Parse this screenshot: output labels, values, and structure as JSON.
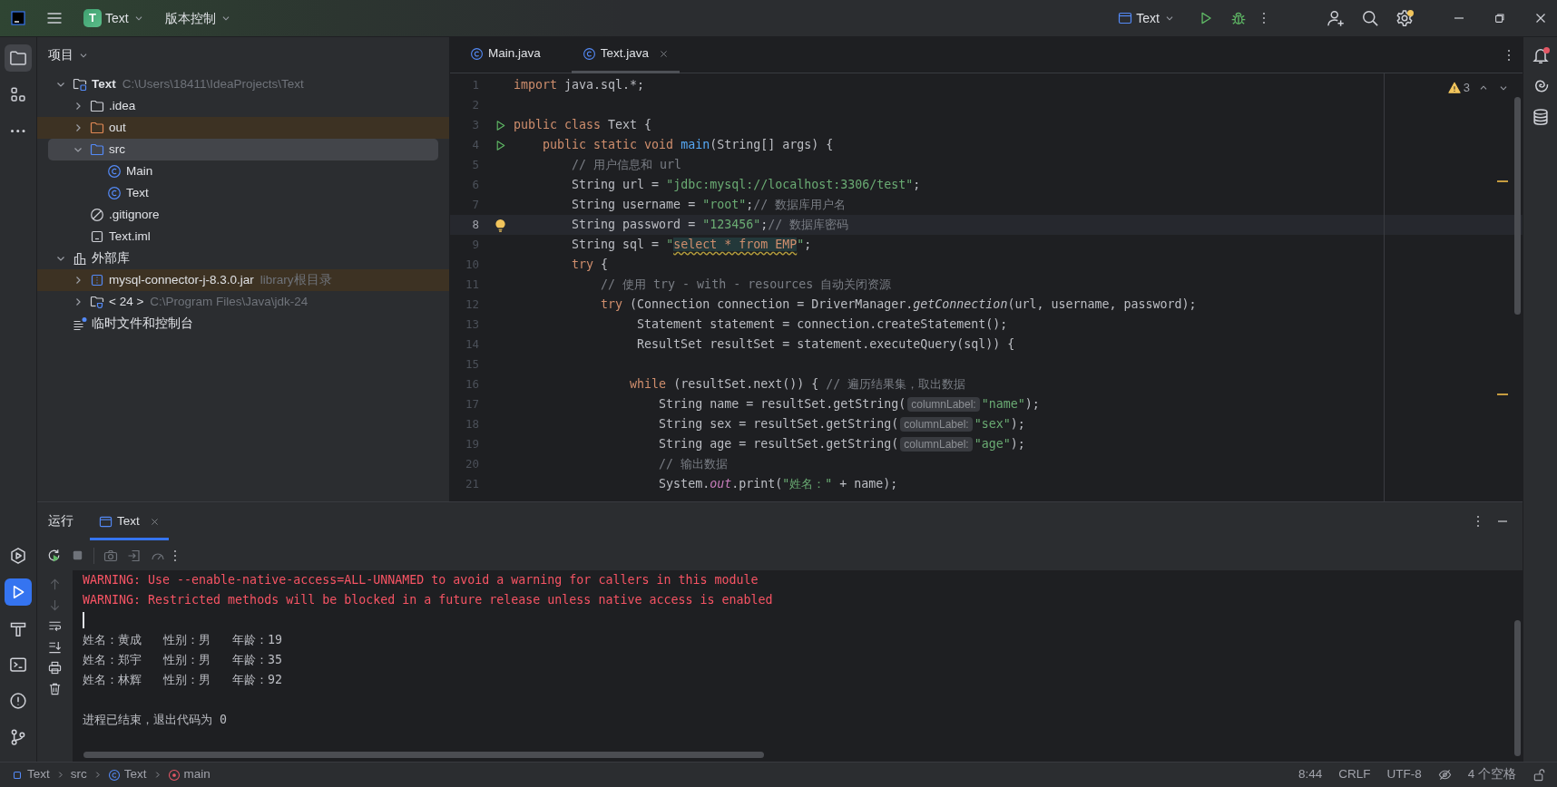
{
  "title_bar": {
    "project_badge": "T",
    "project": "Text",
    "vcs": "版本控制",
    "run_config": "Text",
    "settings_badge": true
  },
  "left_toolbar": {
    "top": [
      {
        "kind": "project",
        "selected": true
      },
      {
        "kind": "structure",
        "selected": false
      },
      {
        "kind": "more",
        "selected": false
      }
    ],
    "bottom": [
      {
        "kind": "services",
        "selected": false
      },
      {
        "kind": "run",
        "selected": true
      },
      {
        "kind": "build",
        "selected": false
      },
      {
        "kind": "terminal",
        "selected": false
      },
      {
        "kind": "problems",
        "selected": false
      },
      {
        "kind": "git",
        "selected": false
      }
    ]
  },
  "project_panel": {
    "title": "项目",
    "tree": [
      {
        "label": "Text",
        "detail": "C:\\Users\\18411\\IdeaProjects\\Text",
        "kind": "project",
        "expanded": true,
        "selected": false,
        "highlighted": false,
        "children": [
          {
            "label": ".idea",
            "kind": "folder",
            "expanded": false,
            "selected": false,
            "highlighted": false
          },
          {
            "label": "out",
            "kind": "folder-excluded",
            "expanded": false,
            "selected": false,
            "highlighted": true
          },
          {
            "label": "src",
            "kind": "folder-source",
            "expanded": true,
            "selected": true,
            "highlighted": false,
            "children": [
              {
                "label": "Main",
                "kind": "class",
                "selected": false,
                "highlighted": false
              },
              {
                "label": "Text",
                "kind": "class",
                "selected": false,
                "highlighted": false
              }
            ]
          },
          {
            "label": ".gitignore",
            "kind": "ignore",
            "selected": false,
            "highlighted": false
          },
          {
            "label": "Text.iml",
            "kind": "iml",
            "selected": false,
            "highlighted": false
          }
        ]
      },
      {
        "label": "外部库",
        "kind": "libraries",
        "expanded": true,
        "selected": false,
        "highlighted": false,
        "children": [
          {
            "label": "mysql-connector-j-8.3.0.jar",
            "detail": "library根目录",
            "kind": "jar",
            "expanded": false,
            "selected": false,
            "highlighted": true
          },
          {
            "label": "< 24 >",
            "detail": "C:\\Program Files\\Java\\jdk-24",
            "kind": "jdk",
            "expanded": false,
            "selected": false,
            "highlighted": false
          }
        ]
      },
      {
        "label": "临时文件和控制台",
        "kind": "scratch",
        "selected": false,
        "highlighted": false
      }
    ]
  },
  "editor": {
    "tabs": [
      {
        "label": "Main.java",
        "selected": false
      },
      {
        "label": "Text.java",
        "selected": true
      }
    ],
    "warnings": "3",
    "lines": [
      {
        "number": "1",
        "current": false,
        "tokens": [
          {
            "kind": "keyword",
            "text": "import"
          },
          {
            "kind": "plain",
            "text": " java.sql.*;"
          }
        ]
      },
      {
        "number": "2",
        "current": false
      },
      {
        "number": "3",
        "current": false,
        "gutter": {
          "kind": "run"
        },
        "tokens": [
          {
            "kind": "keyword",
            "text": "public class"
          },
          {
            "kind": "plain",
            "text": " Text {"
          }
        ]
      },
      {
        "number": "4",
        "current": false,
        "gutter": {
          "kind": "run"
        },
        "tokens": [
          {
            "kind": "keyword",
            "text": "    public static void "
          },
          {
            "kind": "method",
            "text": "main"
          },
          {
            "kind": "plain",
            "text": "(String[] args) {"
          }
        ]
      },
      {
        "number": "5",
        "current": false,
        "tokens": [
          {
            "kind": "comment",
            "text": "        // 用户信息和 url"
          }
        ]
      },
      {
        "number": "6",
        "current": false,
        "tokens": [
          {
            "kind": "plain",
            "text": "        String url = "
          },
          {
            "kind": "string",
            "text": "\"jdbc:mysql://localhost:3306/test\""
          },
          {
            "kind": "plain",
            "text": ";"
          }
        ]
      },
      {
        "number": "7",
        "current": false,
        "tokens": [
          {
            "kind": "plain",
            "text": "        String username = "
          },
          {
            "kind": "string",
            "text": "\"root\""
          },
          {
            "kind": "plain",
            "text": ";"
          },
          {
            "kind": "comment",
            "text": "// 数据库用户名"
          }
        ]
      },
      {
        "number": "8",
        "current": true,
        "gutter": {
          "kind": "bulb"
        },
        "tokens": [
          {
            "kind": "plain",
            "text": "        String password = "
          },
          {
            "kind": "string",
            "text": "\"123456\""
          },
          {
            "kind": "plain",
            "text": ";"
          },
          {
            "kind": "comment",
            "text": "// 数据库密码"
          }
        ]
      },
      {
        "number": "9",
        "current": false,
        "tokens": [
          {
            "kind": "plain",
            "text": "        String sql = "
          },
          {
            "kind": "string",
            "text": "\""
          },
          {
            "kind": "injected",
            "text": "select * from EMP"
          },
          {
            "kind": "string",
            "text": "\""
          },
          {
            "kind": "plain",
            "text": ";"
          }
        ]
      },
      {
        "number": "10",
        "current": false,
        "tokens": [
          {
            "kind": "keyword",
            "text": "        try"
          },
          {
            "kind": "plain",
            "text": " {"
          }
        ]
      },
      {
        "number": "11",
        "current": false,
        "tokens": [
          {
            "kind": "comment",
            "text": "            // 使用 try - with - resources 自动关闭资源"
          }
        ]
      },
      {
        "number": "12",
        "current": false,
        "tokens": [
          {
            "kind": "keyword",
            "text": "            try"
          },
          {
            "kind": "plain",
            "text": " (Connection connection = DriverManager."
          },
          {
            "kind": "italic",
            "text": "getConnection"
          },
          {
            "kind": "plain",
            "text": "(url, username, password);"
          }
        ]
      },
      {
        "number": "13",
        "current": false,
        "tokens": [
          {
            "kind": "plain",
            "text": "                 Statement statement = connection.createStatement();"
          }
        ]
      },
      {
        "number": "14",
        "current": false,
        "tokens": [
          {
            "kind": "plain",
            "text": "                 ResultSet resultSet = statement.executeQuery(sql)) {"
          }
        ]
      },
      {
        "number": "15",
        "current": false
      },
      {
        "number": "16",
        "current": false,
        "tokens": [
          {
            "kind": "keyword",
            "text": "                while"
          },
          {
            "kind": "plain",
            "text": " (resultSet.next()) { "
          },
          {
            "kind": "comment",
            "text": "// 遍历结果集，取出数据"
          }
        ]
      },
      {
        "number": "17",
        "current": false,
        "tokens": [
          {
            "kind": "plain",
            "text": "                    String name = resultSet.getString("
          },
          {
            "kind": "hint",
            "text": "columnLabel:"
          },
          {
            "kind": "string",
            "text": "\"name\""
          },
          {
            "kind": "plain",
            "text": ");"
          }
        ]
      },
      {
        "number": "18",
        "current": false,
        "tokens": [
          {
            "kind": "plain",
            "text": "                    String sex = resultSet.getString("
          },
          {
            "kind": "hint",
            "text": "columnLabel:"
          },
          {
            "kind": "string",
            "text": "\"sex\""
          },
          {
            "kind": "plain",
            "text": ");"
          }
        ]
      },
      {
        "number": "19",
        "current": false,
        "tokens": [
          {
            "kind": "plain",
            "text": "                    String age = resultSet.getString("
          },
          {
            "kind": "hint",
            "text": "columnLabel:"
          },
          {
            "kind": "string",
            "text": "\"age\""
          },
          {
            "kind": "plain",
            "text": ");"
          }
        ]
      },
      {
        "number": "20",
        "current": false,
        "tokens": [
          {
            "kind": "comment",
            "text": "                    // 输出数据"
          }
        ]
      },
      {
        "number": "21",
        "current": false,
        "tokens": [
          {
            "kind": "plain",
            "text": "                    System."
          },
          {
            "kind": "field",
            "text": "out"
          },
          {
            "kind": "plain",
            "text": ".print("
          },
          {
            "kind": "string",
            "text": "\"姓名：\""
          },
          {
            "kind": "plain",
            "text": " + name);"
          }
        ]
      }
    ]
  },
  "run_panel": {
    "title": "运行",
    "tabs": [
      {
        "label": "Text",
        "selected": true
      }
    ],
    "console": [
      {
        "kind": "error",
        "text": "WARNING: Use --enable-native-access=ALL-UNNAMED to avoid a warning for callers in this module"
      },
      {
        "kind": "error",
        "text": "WARNING: Restricted methods will be blocked in a future release unless native access is enabled"
      },
      {
        "kind": "caret"
      },
      {
        "kind": "output",
        "text": "姓名：黄成   性别：男   年龄：19"
      },
      {
        "kind": "output",
        "text": "姓名：郑宇   性别：男   年龄：35"
      },
      {
        "kind": "output",
        "text": "姓名：林辉   性别：男   年龄：92"
      },
      {
        "kind": "blank"
      },
      {
        "kind": "output",
        "text": "进程已结束，退出代码为 0"
      }
    ]
  },
  "status_bar": {
    "breadcrumbs": [
      {
        "label": "Text",
        "kind": "module"
      },
      {
        "label": "src",
        "kind": "folder"
      },
      {
        "label": "Text",
        "kind": "class"
      },
      {
        "label": "main",
        "kind": "method"
      }
    ],
    "right": [
      "8:44",
      "CRLF",
      "UTF-8",
      "4 个空格"
    ]
  },
  "right_toolbar": {
    "notifications_badge": true
  }
}
